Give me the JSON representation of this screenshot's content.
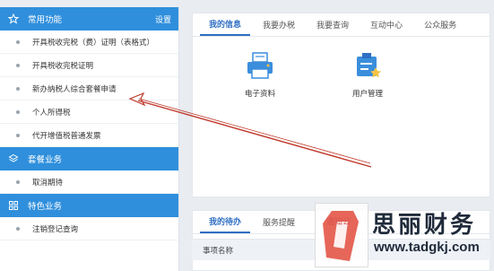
{
  "sidebar": {
    "sections": [
      {
        "title": "常用功能",
        "settings_label": "设置",
        "items": [
          {
            "label": "开具税收完税（费）证明（表格式）"
          },
          {
            "label": "开具税收完税证明"
          },
          {
            "label": "新办纳税人综合套餐申请"
          },
          {
            "label": "个人所得税"
          },
          {
            "label": "代开增值税普通发票"
          }
        ]
      },
      {
        "title": "套餐业务",
        "items": [
          {
            "label": "取消期待"
          }
        ]
      },
      {
        "title": "特色业务",
        "items": [
          {
            "label": "注销登记查询"
          }
        ]
      }
    ]
  },
  "top_panel": {
    "tabs": [
      {
        "label": "我的信息",
        "active": true
      },
      {
        "label": "我要办税"
      },
      {
        "label": "我要查询"
      },
      {
        "label": "互动中心"
      },
      {
        "label": "公众服务"
      }
    ],
    "tiles": [
      {
        "label": "电子资料",
        "icon": "printer-icon"
      },
      {
        "label": "用户管理",
        "icon": "user-management-icon"
      }
    ]
  },
  "bottom_panel": {
    "tabs": [
      {
        "label": "我的待办",
        "active": true
      },
      {
        "label": "服务提醒"
      }
    ],
    "table_header": "事项名称"
  },
  "watermark": {
    "notice": "通知公",
    "brand": "思丽财务",
    "url": "www.tadgkj.com"
  },
  "colors": {
    "accent": "#2f8fdc",
    "tab_active": "#2f6fc4",
    "arrow": "#c0392b"
  }
}
